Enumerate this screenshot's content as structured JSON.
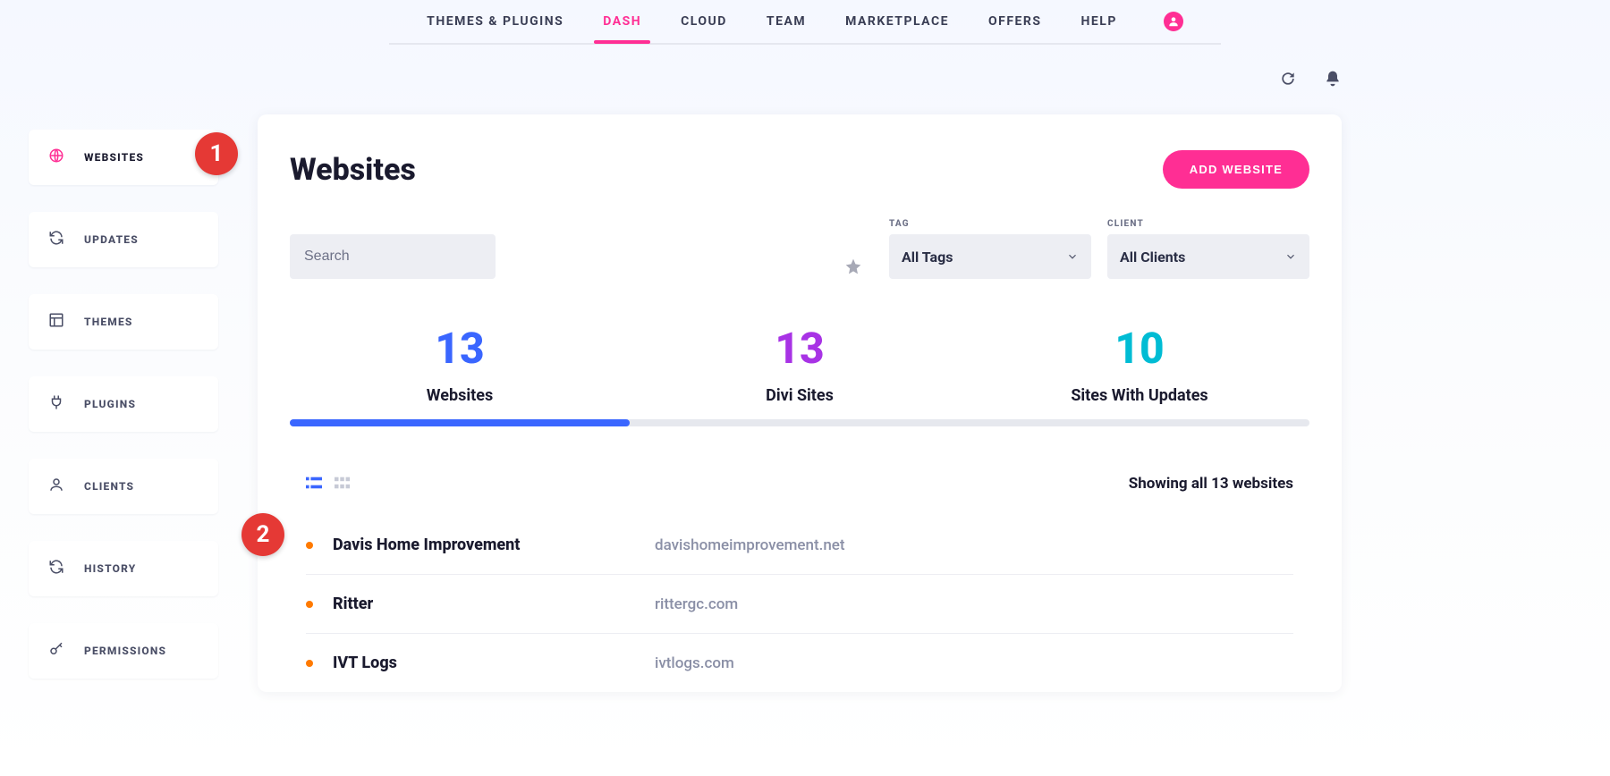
{
  "topnav": {
    "items": [
      "THEMES & PLUGINS",
      "DASH",
      "CLOUD",
      "TEAM",
      "MARKETPLACE",
      "OFFERS",
      "HELP"
    ],
    "active_index": 1
  },
  "sidebar": {
    "items": [
      {
        "label": "WEBSITES",
        "icon": "globe"
      },
      {
        "label": "UPDATES",
        "icon": "refresh"
      },
      {
        "label": "THEMES",
        "icon": "layout"
      },
      {
        "label": "PLUGINS",
        "icon": "plug"
      },
      {
        "label": "CLIENTS",
        "icon": "user"
      },
      {
        "label": "HISTORY",
        "icon": "refresh"
      },
      {
        "label": "PERMISSIONS",
        "icon": "key"
      }
    ],
    "active_index": 0
  },
  "page": {
    "title": "Websites",
    "add_button": "ADD WEBSITE"
  },
  "filters": {
    "search_placeholder": "Search",
    "tag_label": "TAG",
    "tag_value": "All Tags",
    "client_label": "CLIENT",
    "client_value": "All Clients"
  },
  "stats": {
    "websites": {
      "value": "13",
      "label": "Websites"
    },
    "divi_sites": {
      "value": "13",
      "label": "Divi Sites"
    },
    "sites_updates": {
      "value": "10",
      "label": "Sites With Updates"
    }
  },
  "list": {
    "showing": "Showing all 13 websites",
    "rows": [
      {
        "name": "Davis Home Improvement",
        "url": "davishomeimprovement.net"
      },
      {
        "name": "Ritter",
        "url": "rittergc.com"
      },
      {
        "name": "IVT Logs",
        "url": "ivtlogs.com"
      }
    ]
  },
  "annotations": {
    "badge1": "1",
    "badge2": "2"
  }
}
